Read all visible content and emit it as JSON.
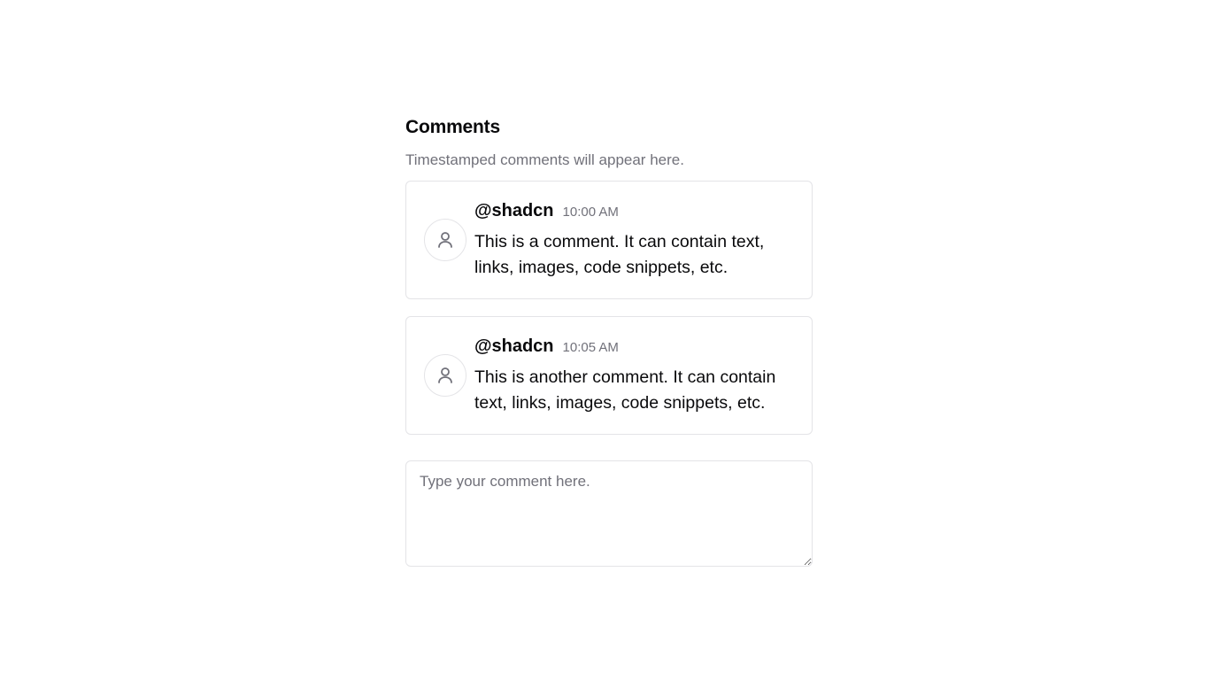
{
  "header": {
    "title": "Comments",
    "subtitle": "Timestamped comments will appear here."
  },
  "comments": [
    {
      "author": "@shadcn",
      "time": "10:00 AM",
      "text": "This is a comment. It can contain text, links, images, code snippets, etc.",
      "avatar_icon": "user-icon"
    },
    {
      "author": "@shadcn",
      "time": "10:05 AM",
      "text": "This is another comment. It can contain text, links, images, code snippets, etc.",
      "avatar_icon": "user-icon"
    }
  ],
  "composer": {
    "placeholder": "Type your comment here.",
    "value": ""
  },
  "colors": {
    "text": "#09090b",
    "muted": "#71717a",
    "border": "#e4e4e7"
  }
}
